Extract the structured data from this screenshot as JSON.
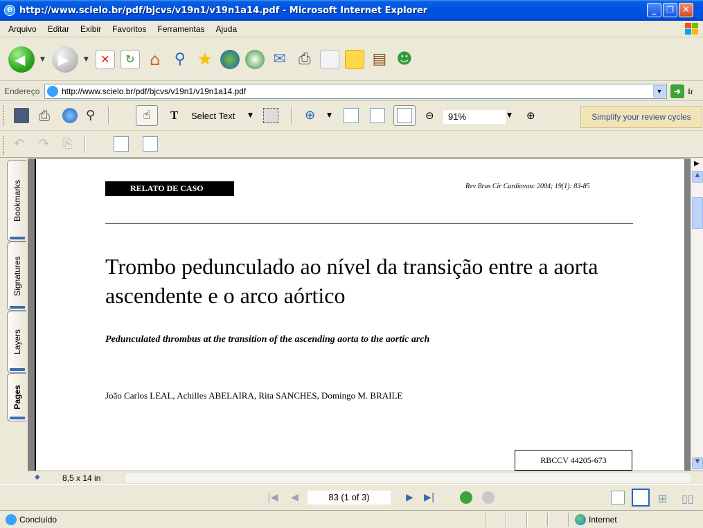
{
  "window": {
    "title": "http://www.scielo.br/pdf/bjcvs/v19n1/v19n1a14.pdf - Microsoft Internet Explorer",
    "minimize": "_",
    "maximize": "❐",
    "close": "✕"
  },
  "menu": {
    "items": [
      "Arquivo",
      "Editar",
      "Exibir",
      "Favoritos",
      "Ferramentas",
      "Ajuda"
    ]
  },
  "address": {
    "label": "Endereço",
    "url": "http://www.scielo.br/pdf/bjcvs/v19n1/v19n1a14.pdf",
    "go_label": "Ir"
  },
  "acrobat": {
    "select_text": "Select Text",
    "zoom": "91%",
    "promo": "Simplify your review cycles"
  },
  "side_tabs": [
    "Bookmarks",
    "Signatures",
    "Layers",
    "Pages"
  ],
  "document": {
    "section_label": "RELATO DE CASO",
    "journal_ref": "Rev Bras Cir Cardiovasc 2004; 19(1): 83-85",
    "title": "Trombo pedunculado ao nível da transição entre a aorta ascendente e o arco aórtico",
    "subtitle": "Pedunculated thrombus at the transition of the ascending aorta to the aortic arch",
    "authors": "João Carlos LEAL, Achilles ABELAIRA, Rita SANCHES, Domingo M. BRAILE",
    "code": "RBCCV 44205-673"
  },
  "page_size": "8,5 x 14 in",
  "navigation": {
    "page_display": "83  (1 of 3)"
  },
  "status": {
    "text": "Concluído",
    "zone": "Internet"
  },
  "colors": {
    "title_bar": "#0054e3",
    "chrome": "#ece9d8",
    "promo_bg": "#f0e4b8"
  }
}
